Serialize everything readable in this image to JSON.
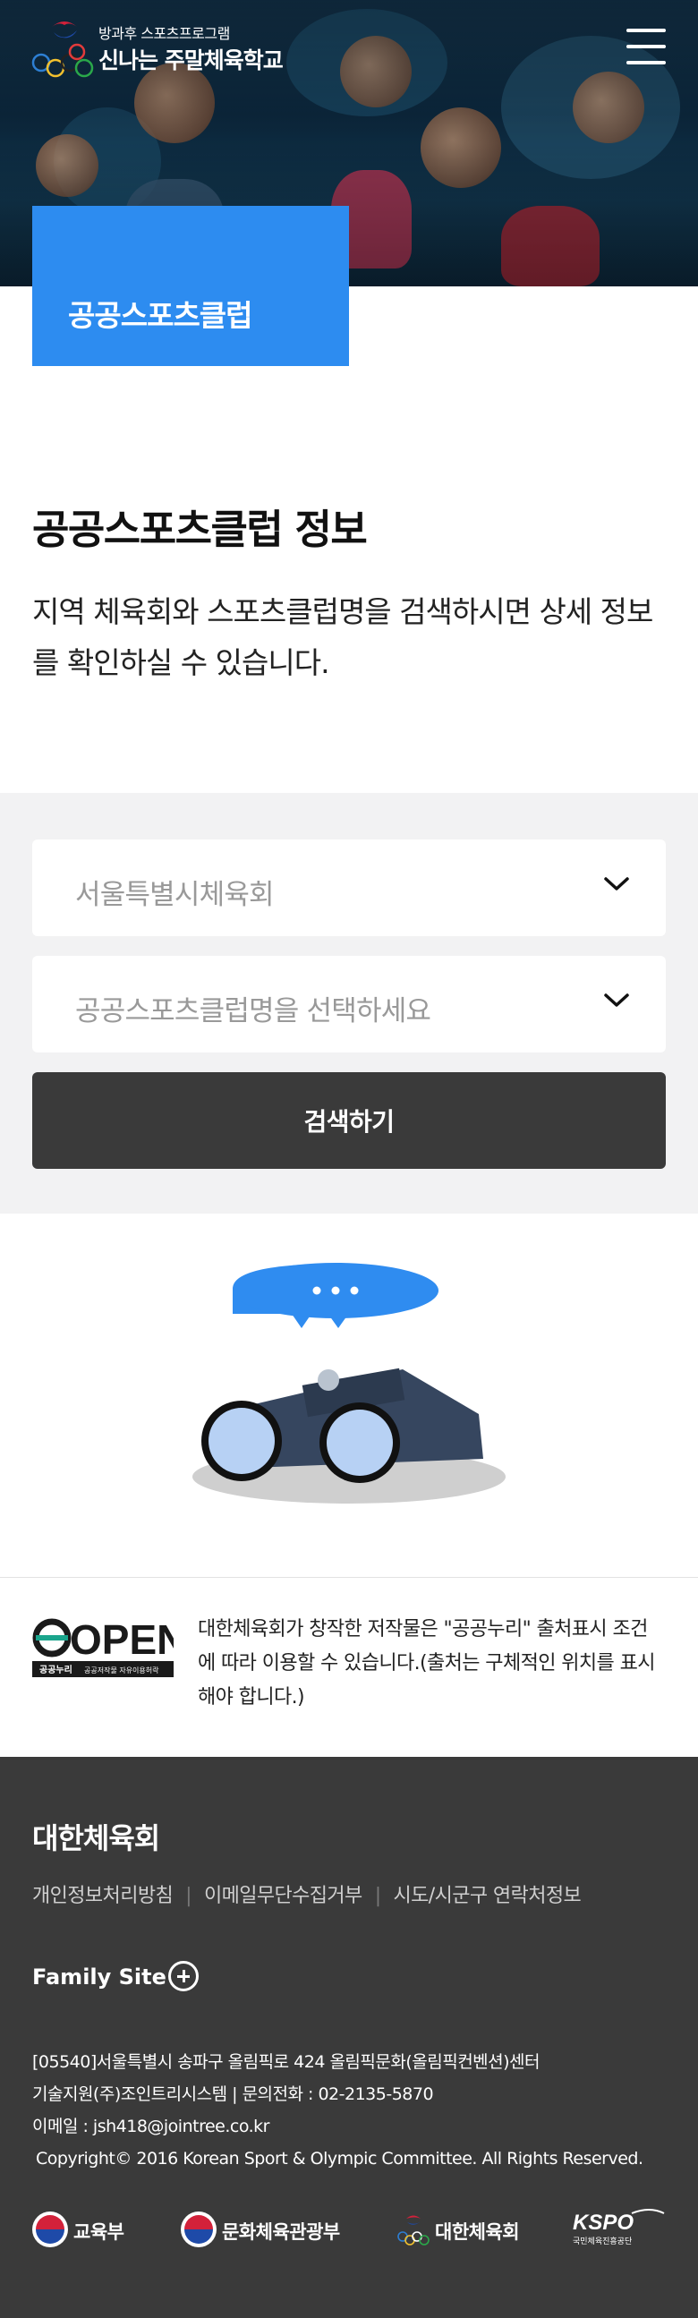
{
  "header": {
    "logo_small": "방과후 스포츠프로그램",
    "logo_big": "신나는 주말체육학교",
    "menu_icon": "hamburger-menu-icon"
  },
  "hero": {
    "tab_label": "공공스포츠클럽"
  },
  "intro": {
    "title": "공공스포츠클럽 정보",
    "description": "지역 체육회와 스포츠클럽명을 검색하시면 상세 정보를 확인하실 수 있습니다."
  },
  "search": {
    "region_select": "서울특별시체육회",
    "club_select_placeholder": "공공스포츠클럽명을 선택하세요",
    "button_label": "검색하기"
  },
  "open_license": {
    "logo_text": "OPEN",
    "logo_caption_left": "공공누리",
    "logo_caption_right": "공공저작물 자유이용허락",
    "text": "대한체육회가 창작한 저작물은 \"공공누리\" 출처표시 조건에 따라 이용할 수 있습니다.(출처는 구체적인 위치를 표시해야 합니다.)"
  },
  "footer": {
    "org_name": "대한체육회",
    "links": [
      "개인정보처리방침",
      "이메일무단수집거부",
      "시도/시군구 연락처정보"
    ],
    "family_site": "Family Site",
    "address": "[05540]서울특별시 송파구 올림픽로 424 올림픽문화(올림픽컨벤션)센터",
    "support": "기술지원(주)조인트리시스템 | 문의전화 : 02-2135-5870",
    "email": "이메일 : jsh418@jointree.co.kr",
    "copyright": "Copyright© 2016 Korean Sport & Olympic Committee. All Rights Reserved.",
    "partners": [
      "교육부",
      "문화체육관광부",
      "대한체육회",
      "KSPO"
    ],
    "kspo_caption": "국민체육진흥공단"
  },
  "colors": {
    "accent_blue": "#2d8cf0",
    "dark_button": "#3a3a3a",
    "footer_bg": "#3a3a3a",
    "search_bg": "#f2f2f3"
  }
}
